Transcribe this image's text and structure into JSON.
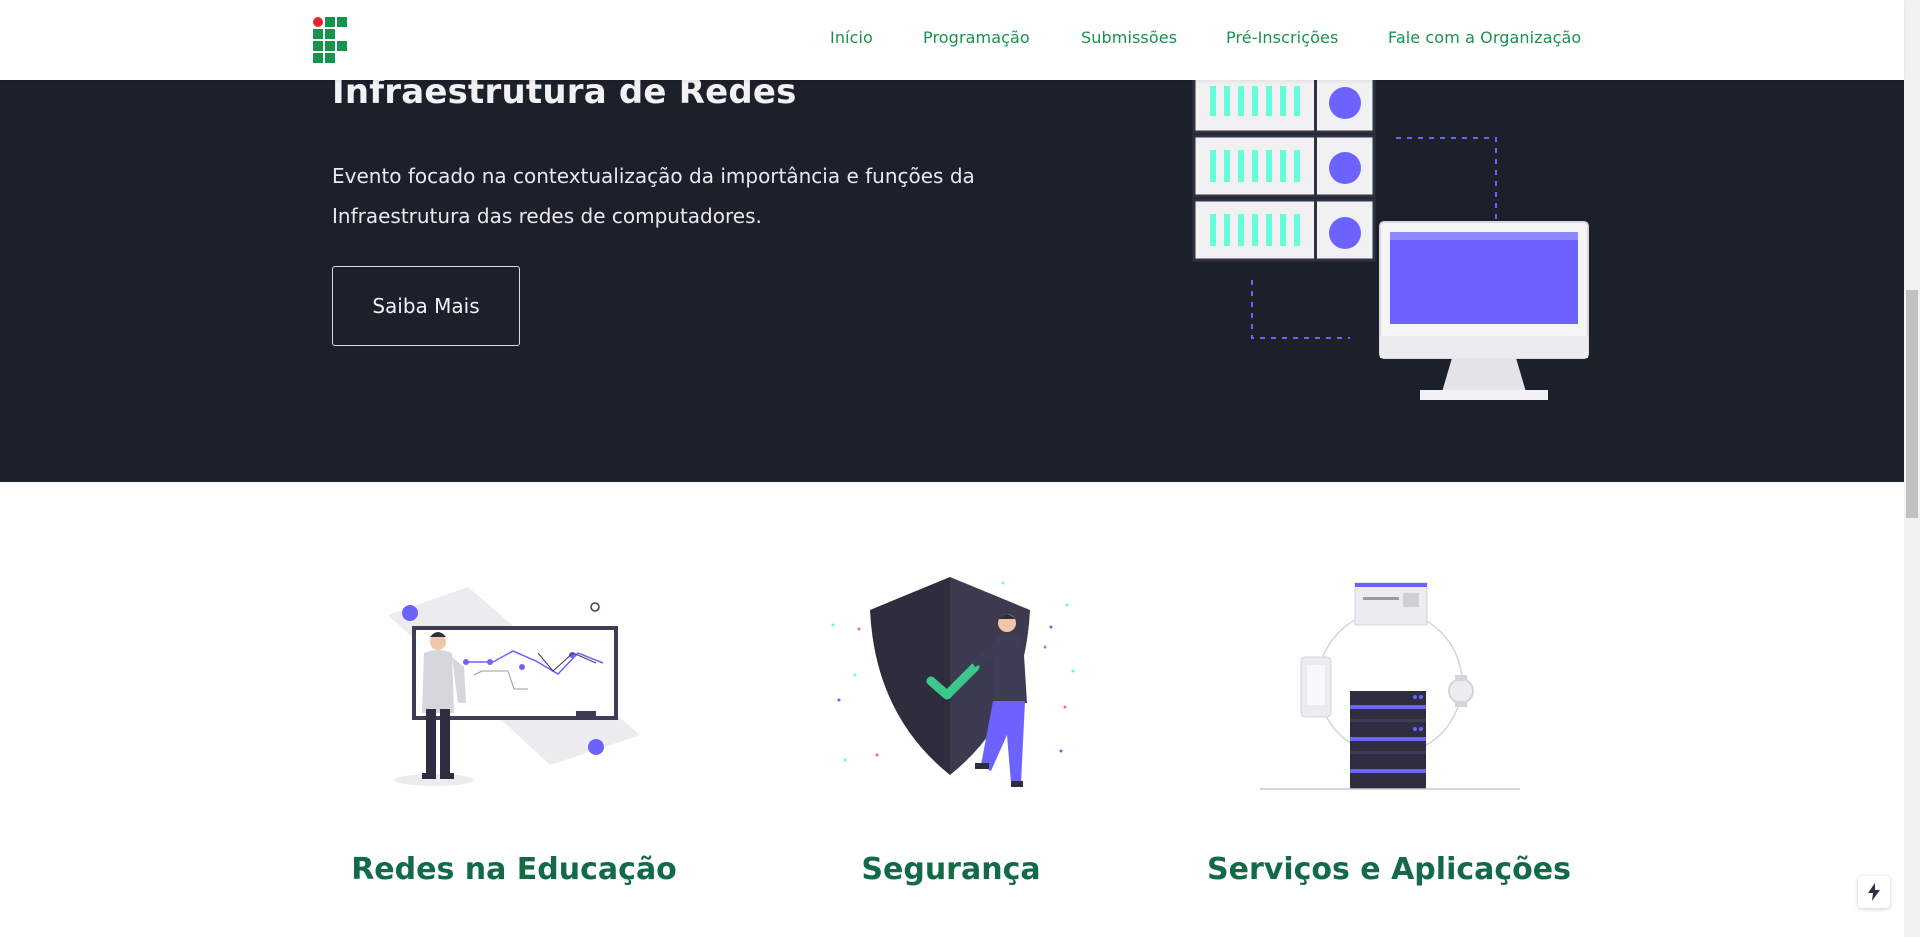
{
  "nav": {
    "items": [
      {
        "label": "Início"
      },
      {
        "label": "Programação"
      },
      {
        "label": "Submissões"
      },
      {
        "label": "Pré-Inscrições"
      },
      {
        "label": "Fale com a Organização"
      }
    ]
  },
  "hero": {
    "title": "Infraestrutura de Redes",
    "description": "Evento focado na contextualização da importância e funções da Infraestrutura das redes de computadores.",
    "button_label": "Saiba Mais"
  },
  "features": [
    {
      "title": "Redes na Educação",
      "icon": "teaching-board-illustration"
    },
    {
      "title": "Segurança",
      "icon": "security-shield-illustration"
    },
    {
      "title": "Serviços e Aplicações",
      "icon": "server-devices-illustration"
    }
  ],
  "colors": {
    "brand_green": "#17934d",
    "logo_red": "#e0262b",
    "hero_bg": "#1c202b",
    "accent_purple": "#6c63ff",
    "accent_teal": "#64ffda",
    "feature_title": "#136a46"
  }
}
